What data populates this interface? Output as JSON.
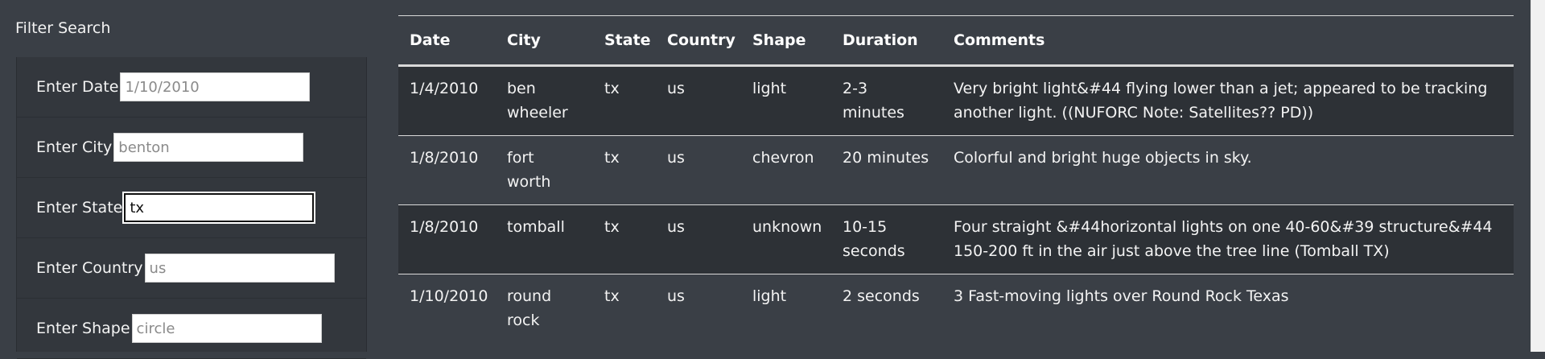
{
  "filter": {
    "title": "Filter Search",
    "fields": [
      {
        "label": "Enter Date",
        "placeholder": "1/10/2010",
        "value": ""
      },
      {
        "label": "Enter City",
        "placeholder": "benton",
        "value": ""
      },
      {
        "label": "Enter State",
        "placeholder": "",
        "value": "tx"
      },
      {
        "label": "Enter Country",
        "placeholder": "us",
        "value": ""
      },
      {
        "label": "Enter Shape",
        "placeholder": "circle",
        "value": ""
      }
    ]
  },
  "table": {
    "headers": [
      "Date",
      "City",
      "State",
      "Country",
      "Shape",
      "Duration",
      "Comments"
    ],
    "rows": [
      [
        "1/4/2010",
        "ben wheeler",
        "tx",
        "us",
        "light",
        "2-3 minutes",
        "Very bright light&#44 flying lower than a jet; appeared to be tracking another light. ((NUFORC Note: Satellites?? PD))"
      ],
      [
        "1/8/2010",
        "fort worth",
        "tx",
        "us",
        "chevron",
        "20 minutes",
        "Colorful and bright huge objects in sky."
      ],
      [
        "1/8/2010",
        "tomball",
        "tx",
        "us",
        "unknown",
        "10-15 seconds",
        "Four straight &#44horizontal lights on one 40-60&#39 structure&#44 150-200 ft in the air just above the tree line (Tomball TX)"
      ],
      [
        "1/10/2010",
        "round rock",
        "tx",
        "us",
        "light",
        "2 seconds",
        "3 Fast-moving lights over Round Rock Texas"
      ]
    ]
  }
}
